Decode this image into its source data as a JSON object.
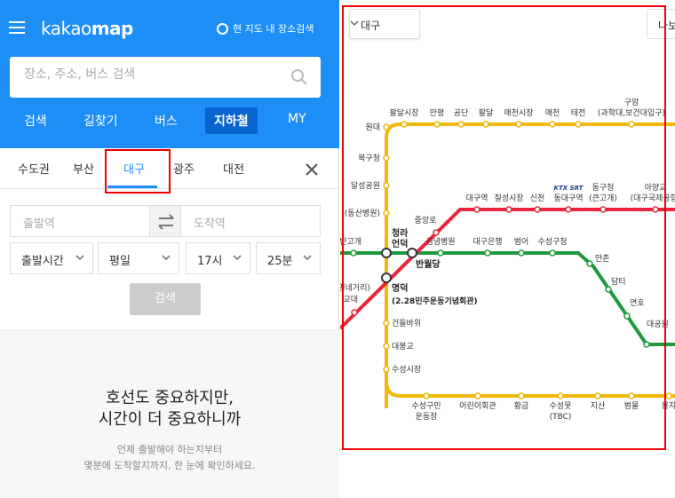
{
  "app": {
    "logo_main": "kakao",
    "logo_bold": "map"
  },
  "header": {
    "nearby_radio_label": "현 지도 내 장소검색"
  },
  "search": {
    "placeholder": "장소, 주소, 버스 검색"
  },
  "nav_tabs": [
    "검색",
    "길찾기",
    "버스",
    "지하철",
    "MY"
  ],
  "active_nav": "지하철",
  "city_tabs": [
    "수도권",
    "부산",
    "대구",
    "광주",
    "대전"
  ],
  "active_city": "대구",
  "route": {
    "from_placeholder": "출발역",
    "to_placeholder": "도착역",
    "time_type": "출발시간",
    "day": "평일",
    "hour": "17시",
    "minute": "25분",
    "search_label": "검색"
  },
  "promo": {
    "title_line1": "호선도 중요하지만,",
    "title_line2": "시간이 더 중요하니까",
    "sub_line1": "언제 출발해야 하는지부터",
    "sub_line2": "몇분에 도착할지까지, 한 눈에 확인하세요."
  },
  "map": {
    "city_select": "대구",
    "right_button": "나보",
    "line_colors": {
      "line1": "#e8253d",
      "line2": "#1e9a3c",
      "line3": "#f2b70b"
    },
    "stations_line3_top": [
      "팔달시장",
      "만평",
      "공단",
      "팔달",
      "매천시장",
      "매천",
      "태전",
      "구암"
    ],
    "stations_line3_top_sub": "(과학대,보건대입구)",
    "stations_line3_left": [
      "원대",
      "북구청",
      "달성공원"
    ],
    "stations_line3_left_partial": "(동산병원)",
    "stations_line3_bottom_left": [
      "건들바위",
      "대봉교",
      "수성시장"
    ],
    "stations_line3_bottom": [
      {
        "name": "수성구민",
        "sub": "운동장"
      },
      {
        "name": "어린이회관",
        "sub": ""
      },
      {
        "name": "황금",
        "sub": ""
      },
      {
        "name": "수성못",
        "sub": "(TBC)"
      },
      {
        "name": "지산",
        "sub": ""
      },
      {
        "name": "범물",
        "sub": ""
      },
      {
        "name": "용지",
        "sub": ""
      }
    ],
    "stations_line1": [
      "중앙로",
      "대구역",
      "칠성시장",
      "신천",
      "동대구역",
      "동구청",
      "아양교"
    ],
    "line1_sub_donggu": "(큰고개)",
    "line1_sub_ayang": "(대구국제공항)",
    "ktx_label": "KTX SRT",
    "stations_line2": [
      "김녕병원",
      "대구은행",
      "범어",
      "수성구청",
      "만촌",
      "담티",
      "연호",
      "대공원"
    ],
    "line2_left": "반고개",
    "line1_left": "교대",
    "line2_left_sub": "(계명네거리)",
    "transfers": {
      "cheongna": {
        "name1": "청라",
        "name2": "언덕"
      },
      "banwoldang": "반월당",
      "myeongdeok": {
        "name": "명덕",
        "sub": "(2.28민주운동기념회관)"
      }
    }
  }
}
